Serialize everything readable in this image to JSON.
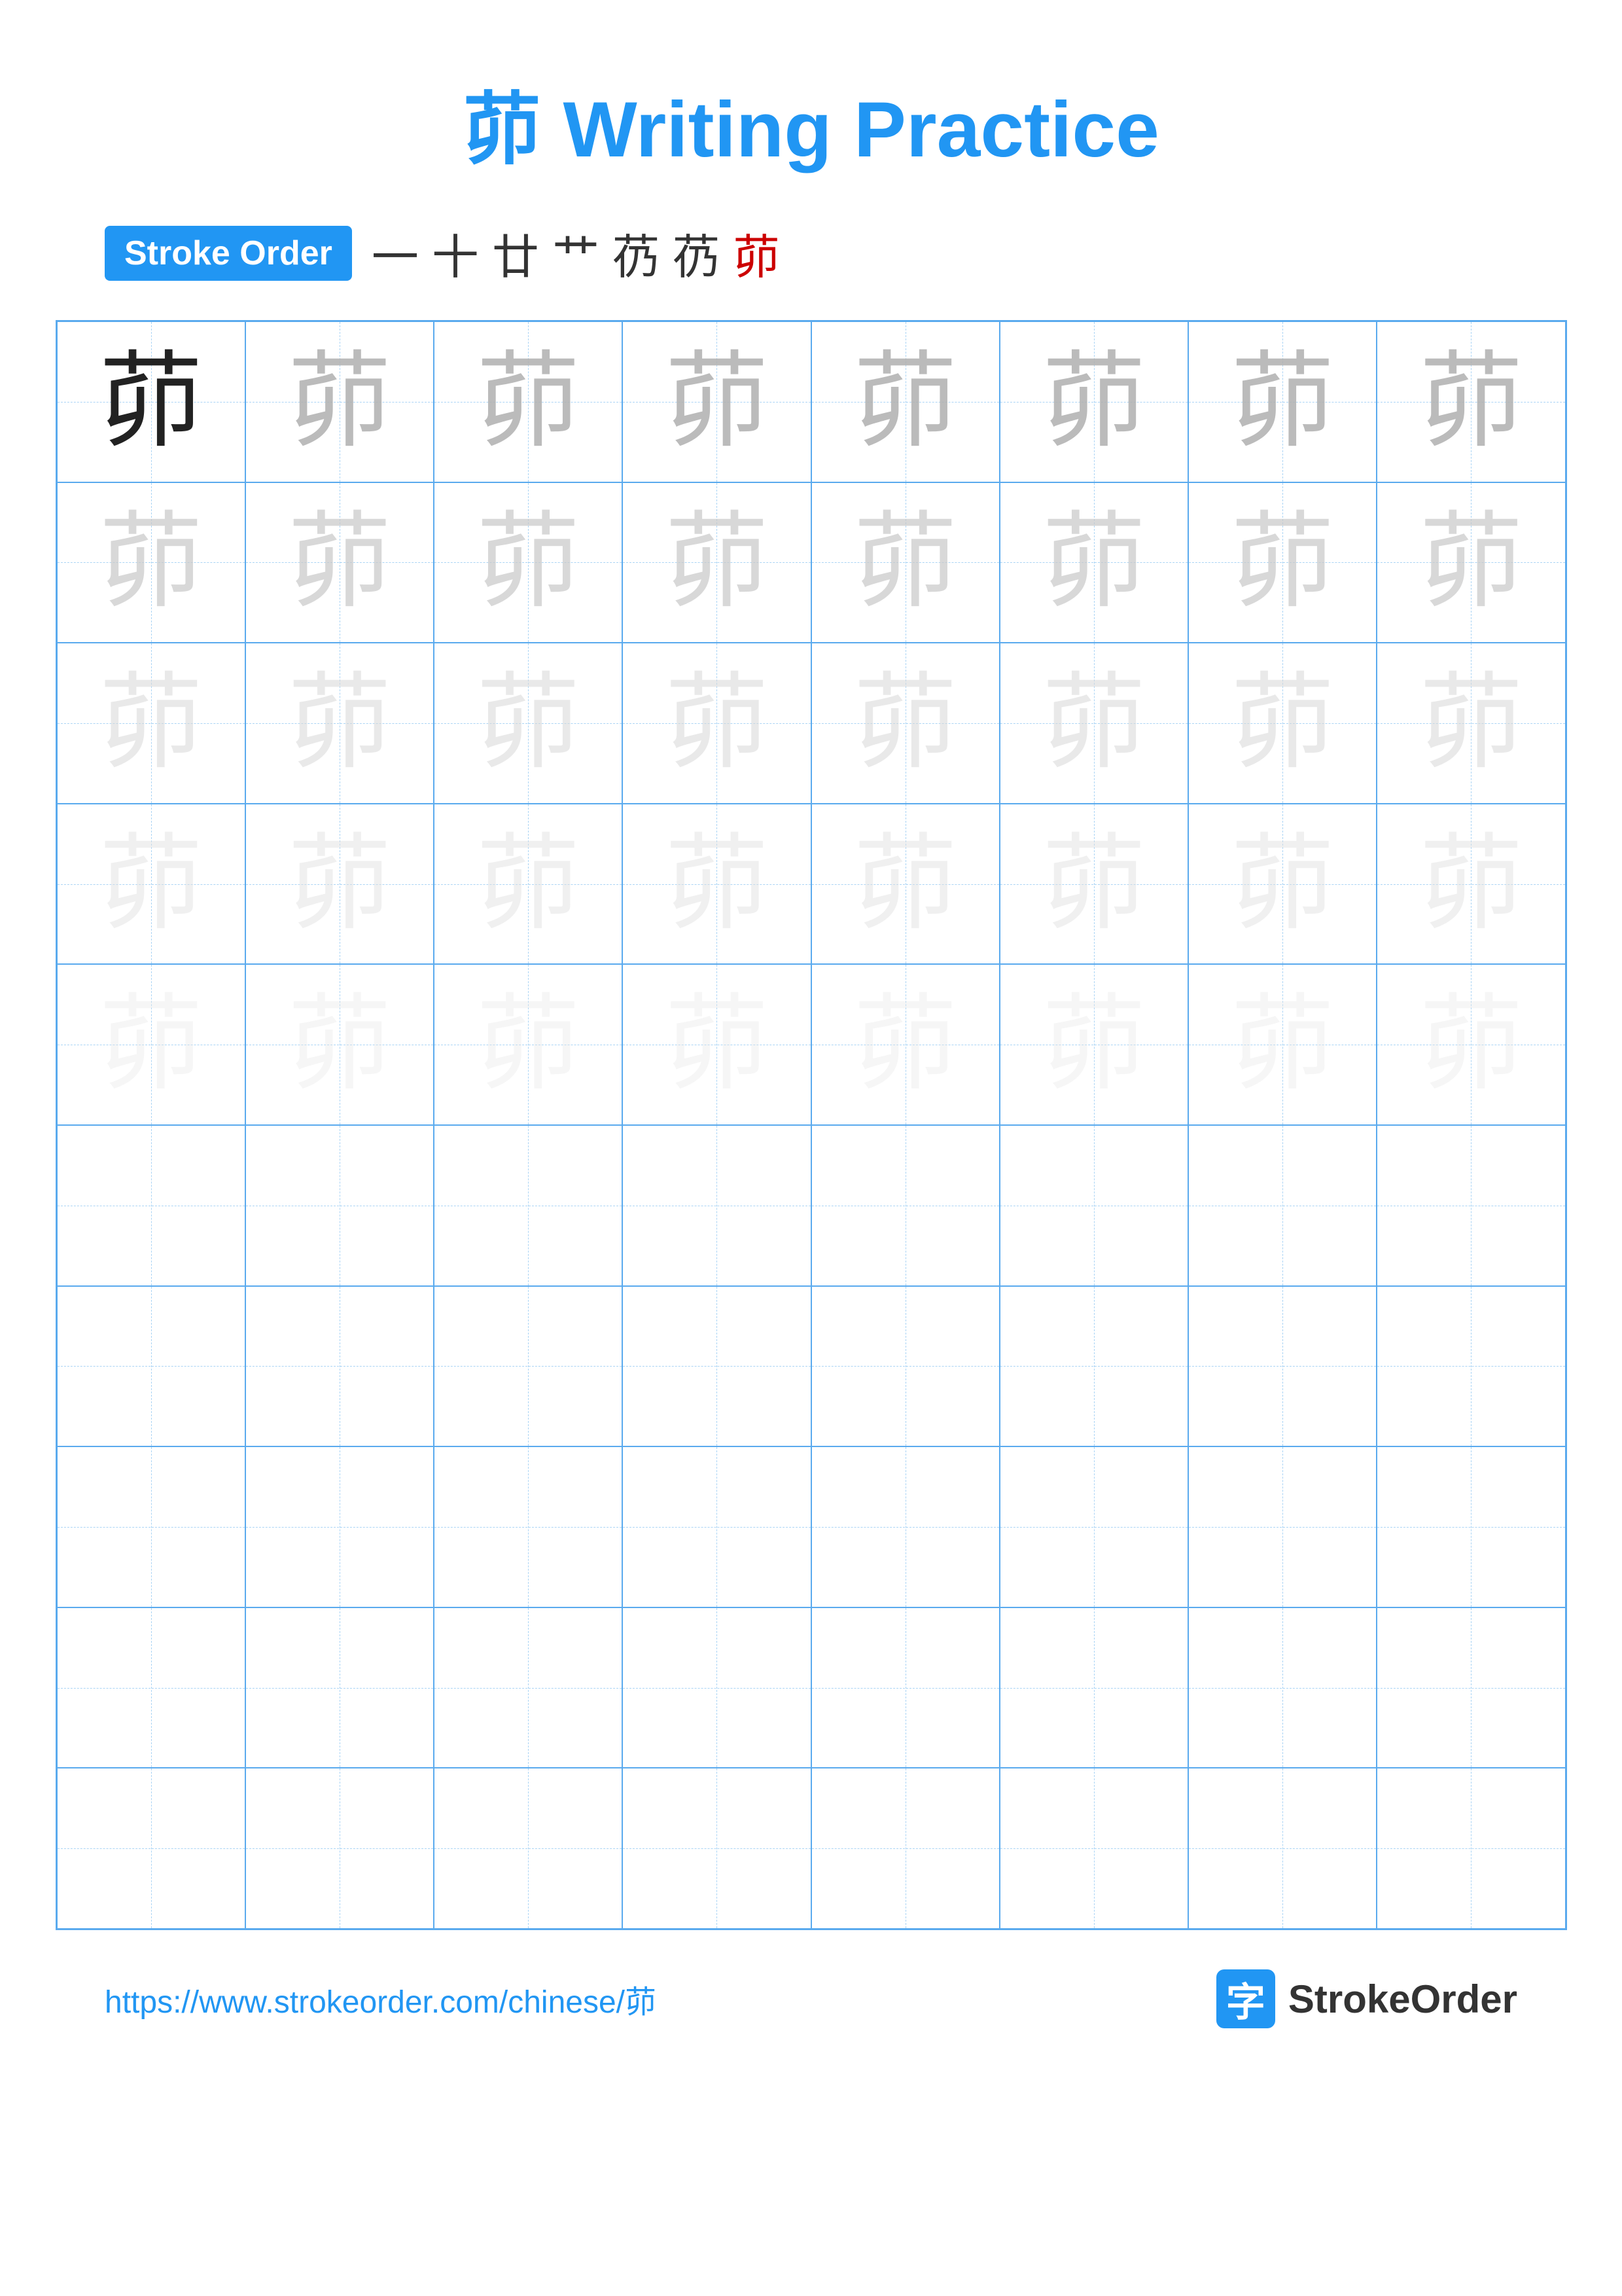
{
  "title": {
    "char": "茆",
    "label": "Writing Practice",
    "full": "茆 Writing Practice"
  },
  "stroke_order": {
    "badge_label": "Stroke Order",
    "strokes": [
      "一",
      "十",
      "廿",
      "艹",
      "芿",
      "芿",
      "茆"
    ],
    "last_stroke_index": 6
  },
  "grid": {
    "cols": 8,
    "rows": 10,
    "char": "茆",
    "filled_rows": 5,
    "opacity_levels": [
      "dark",
      "light1",
      "light2",
      "light3",
      "light4",
      "light5"
    ]
  },
  "footer": {
    "url": "https://www.strokeorder.com/chinese/茆",
    "brand_char": "字",
    "brand_name": "StrokeOrder"
  }
}
